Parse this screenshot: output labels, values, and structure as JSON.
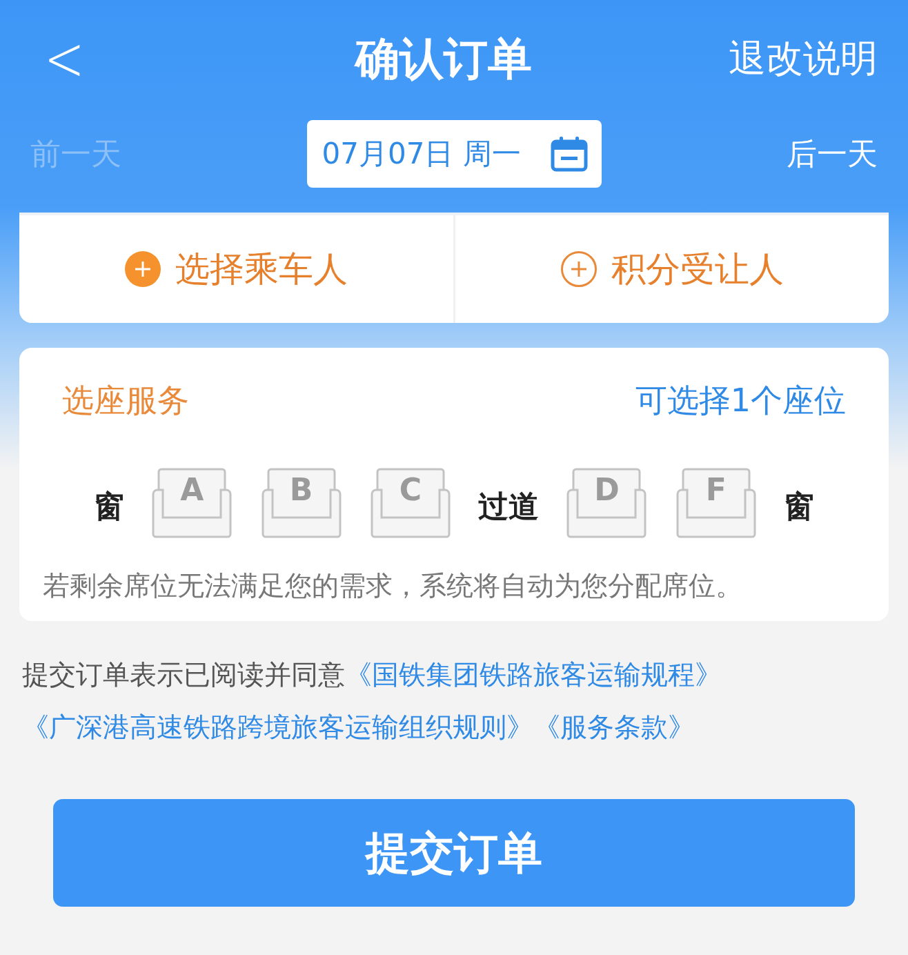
{
  "header": {
    "back": "<",
    "title": "确认订单",
    "action": "退改说明"
  },
  "date_bar": {
    "prev": {
      "label": "前一天",
      "disabled": true
    },
    "date": "07月07日 周一",
    "next": {
      "label": "后一天",
      "disabled": false
    }
  },
  "people": [
    {
      "label": "选择乘车人",
      "kind": "filled"
    },
    {
      "label": "积分受让人",
      "kind": "outline"
    }
  ],
  "seat_service": {
    "title": "选座服务",
    "hint": "可选择1个座位",
    "items": [
      {
        "kind": "label",
        "text": "窗"
      },
      {
        "kind": "seat",
        "text": "A",
        "selected": false
      },
      {
        "kind": "seat",
        "text": "B",
        "selected": false
      },
      {
        "kind": "seat",
        "text": "C",
        "selected": false
      },
      {
        "kind": "label",
        "text": "过道"
      },
      {
        "kind": "seat",
        "text": "D",
        "selected": false
      },
      {
        "kind": "seat",
        "text": "F",
        "selected": false
      },
      {
        "kind": "label",
        "text": "窗"
      }
    ],
    "note": "若剩余席位无法满足您的需求，系统将自动为您分配席位。"
  },
  "agreement": {
    "text": "提交订单表示已阅读并同意",
    "links": [
      "《国铁集团铁路旅客运输规程》",
      "《广深港高速铁路跨境旅客运输组织规则》",
      "《服务条款》"
    ]
  },
  "submit": "提交订单"
}
